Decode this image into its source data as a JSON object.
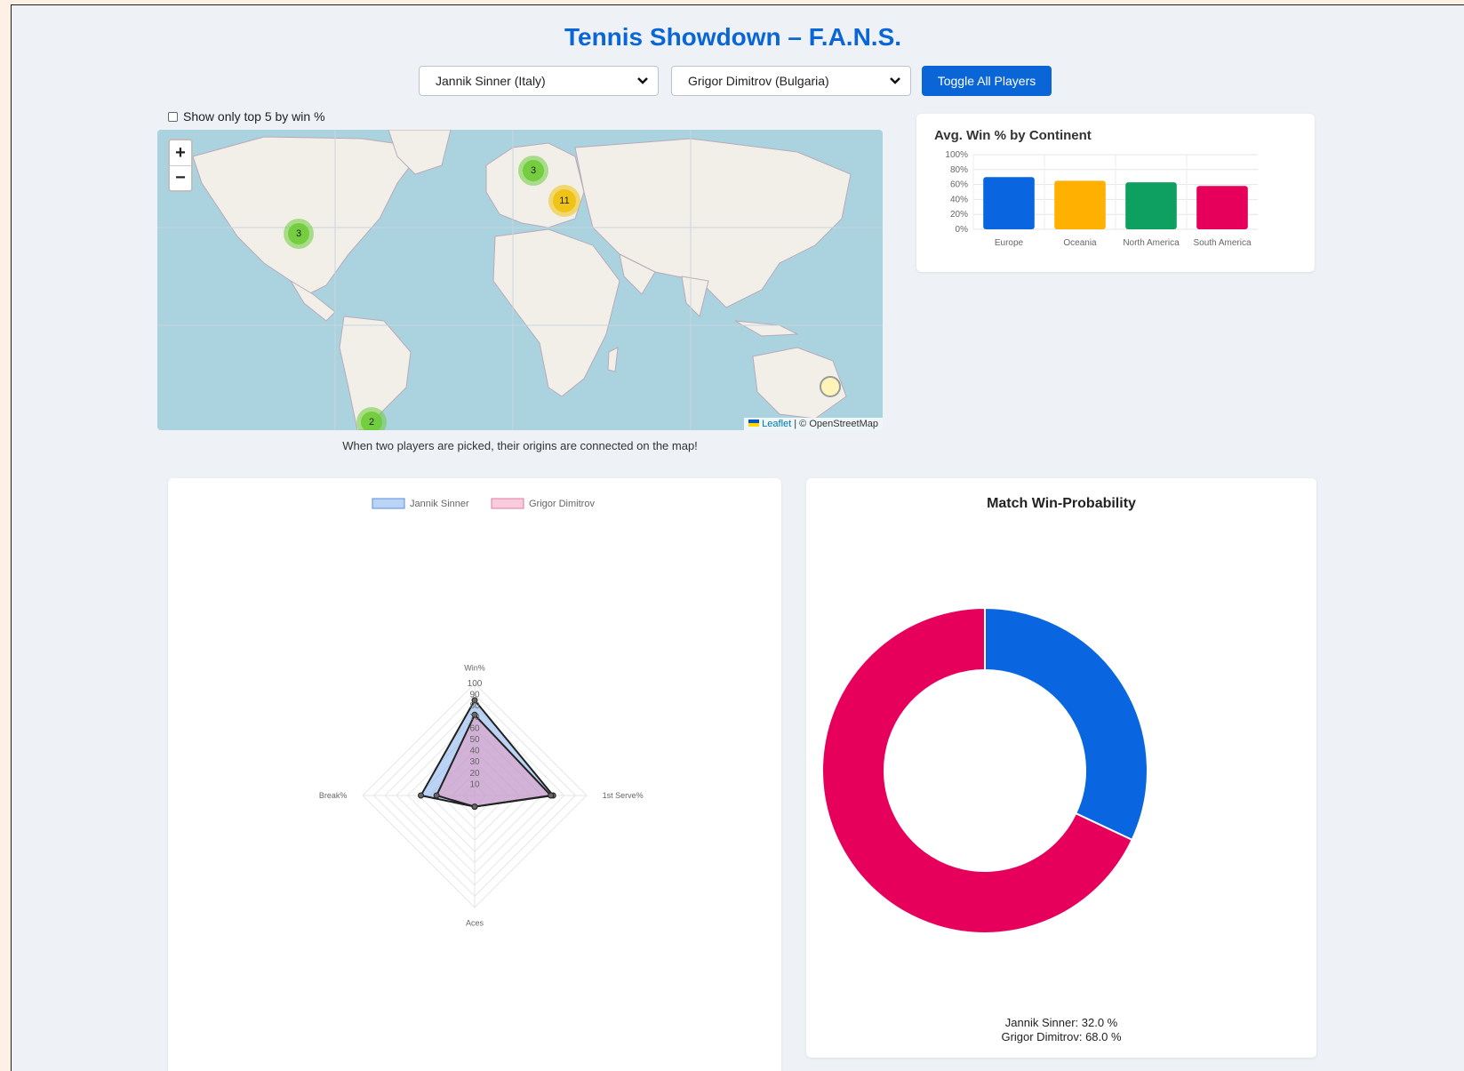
{
  "header": {
    "title": "Tennis Showdown – F.A.N.S."
  },
  "controls": {
    "player1": "Jannik Sinner (Italy)",
    "player2": "Grigor Dimitrov (Bulgaria)",
    "toggle_label": "Toggle All Players",
    "top5_label": "Show only top 5 by win %"
  },
  "map": {
    "zoom_in": "+",
    "zoom_out": "−",
    "clusters": [
      {
        "count": "3",
        "region": "North America",
        "color": "green"
      },
      {
        "count": "3",
        "region": "Northern Europe",
        "color": "green"
      },
      {
        "count": "11",
        "region": "Europe",
        "color": "yellow"
      },
      {
        "count": "2",
        "region": "South America",
        "color": "green"
      },
      {
        "count": "",
        "region": "Australia",
        "color": "yellow"
      }
    ],
    "attribution_link": "Leaflet",
    "attribution_text": " | © OpenStreetMap",
    "caption": "When two players are picked, their origins are connected on the map!"
  },
  "chart_data": [
    {
      "type": "bar",
      "title": "Avg. Win % by Continent",
      "categories": [
        "Europe",
        "Oceania",
        "North America",
        "South America"
      ],
      "values": [
        70,
        65,
        63,
        58
      ],
      "colors": [
        "#0a66e0",
        "#ffb000",
        "#0ea060",
        "#e6005c"
      ],
      "ylim": [
        0,
        100
      ],
      "yticks": [
        "0%",
        "20%",
        "40%",
        "60%",
        "80%",
        "100%"
      ],
      "grid": true,
      "legend": "none"
    },
    {
      "type": "radar",
      "axes": [
        "Win%",
        "1st Serve%",
        "Aces",
        "Break%"
      ],
      "ticks": [
        "10",
        "20",
        "30",
        "40",
        "50",
        "60",
        "70",
        "80",
        "90",
        "100"
      ],
      "range": [
        0,
        100
      ],
      "legend": "top",
      "series": [
        {
          "name": "Jannik Sinner",
          "values": [
            85,
            70,
            10,
            48
          ],
          "fill": "rgba(120,170,235,0.5)"
        },
        {
          "name": "Grigor Dimitrov",
          "values": [
            72,
            68,
            10,
            34
          ],
          "fill": "rgba(240,140,180,0.45)"
        }
      ]
    },
    {
      "type": "pie",
      "title": "Match Win-Probability",
      "labels": [
        "Jannik Sinner",
        "Grigor Dimitrov"
      ],
      "values": [
        32.0,
        68.0
      ],
      "colors": [
        "#0a66e0",
        "#e6005c"
      ],
      "summary": [
        "Jannik Sinner: 32.0 %",
        "Grigor Dimitrov: 68.0 %"
      ]
    }
  ]
}
